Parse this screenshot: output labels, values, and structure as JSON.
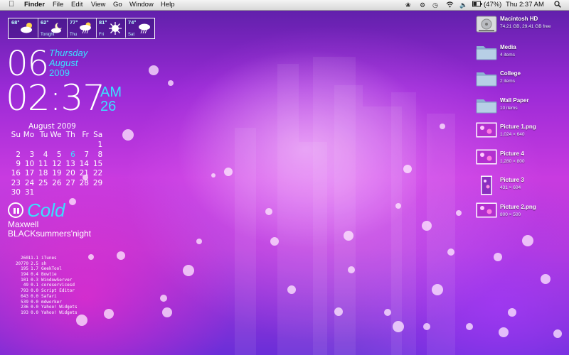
{
  "menubar": {
    "app_name": "Finder",
    "menus": [
      "File",
      "Edit",
      "View",
      "Go",
      "Window",
      "Help"
    ],
    "battery": "(47%)",
    "clock": "Thu 2:37 AM",
    "status_icons": [
      "paw-icon",
      "gear-icon",
      "time-machine-icon",
      "wifi-icon",
      "volume-icon",
      "battery-icon",
      "spotlight-icon"
    ]
  },
  "weather": [
    {
      "temp": "68°",
      "label": "",
      "icon": "partly-cloudy-icon"
    },
    {
      "temp": "62°",
      "label": "Tonight",
      "icon": "partly-cloudy-night-icon"
    },
    {
      "temp": "77°",
      "label": "Thu",
      "icon": "thunderstorm-icon"
    },
    {
      "temp": "81°",
      "label": "Fri",
      "icon": "sunny-icon"
    },
    {
      "temp": "74°",
      "label": "Sat",
      "icon": "thunderstorm-icon"
    }
  ],
  "clock": {
    "day": "06",
    "weekday": "Thursday",
    "month": "August",
    "year": "2009",
    "time": "02:37",
    "ampm": "AM",
    "seconds": "26"
  },
  "calendar": {
    "title": "August 2009",
    "headers": [
      "Su",
      "Mo",
      "Tu",
      "We",
      "Th",
      "Fr",
      "Sa"
    ],
    "weeks": [
      [
        "",
        "",
        "",
        "",
        "",
        "",
        "1"
      ],
      [
        "2",
        "3",
        "4",
        "5",
        "6",
        "7",
        "8"
      ],
      [
        "9",
        "10",
        "11",
        "12",
        "13",
        "14",
        "15"
      ],
      [
        "16",
        "17",
        "18",
        "19",
        "20",
        "21",
        "22"
      ],
      [
        "23",
        "24",
        "25",
        "26",
        "27",
        "28",
        "29"
      ],
      [
        "30",
        "31",
        "",
        "",
        "",
        "",
        ""
      ]
    ],
    "today": "6"
  },
  "now_playing": {
    "title": "Cold",
    "artist": "Maxwell",
    "album": "BLACKsummers'night"
  },
  "processes": [
    [
      "260",
      "11.1",
      "iTunes"
    ],
    [
      "20770",
      "2.5",
      "sh"
    ],
    [
      "195",
      "1.7",
      "GeekTool"
    ],
    [
      "194",
      "0.4",
      "Bowtie"
    ],
    [
      "101",
      "0.3",
      "WindowServer"
    ],
    [
      "49",
      "0.1",
      "coreservicesd"
    ],
    [
      "793",
      "0.0",
      "Script Editor"
    ],
    [
      "643",
      "0.0",
      "Safari"
    ],
    [
      "539",
      "0.0",
      "mdworker"
    ],
    [
      "236",
      "0.0",
      "Yahoo! Widgets"
    ],
    [
      "193",
      "0.0",
      "Yahoo! Widgets"
    ]
  ],
  "desktop_icons": [
    {
      "name": "Macintosh HD",
      "info": "74.21 GB, 29.41 GB free",
      "kind": "hard-drive-icon"
    },
    {
      "name": "Media",
      "info": "4 items",
      "kind": "folder-icon"
    },
    {
      "name": "College",
      "info": "2 items",
      "kind": "folder-icon"
    },
    {
      "name": "Wall Paper",
      "info": "10 items",
      "kind": "folder-icon"
    },
    {
      "name": "Picture 1.png",
      "info": "1,024 × 640",
      "kind": "image-file-icon"
    },
    {
      "name": "Picture 4",
      "info": "1,280 × 800",
      "kind": "image-file-icon"
    },
    {
      "name": "Picture 3",
      "info": "431 × 604",
      "kind": "image-file-icon"
    },
    {
      "name": "Picture 2.png",
      "info": "800 × 500",
      "kind": "image-file-icon"
    }
  ]
}
